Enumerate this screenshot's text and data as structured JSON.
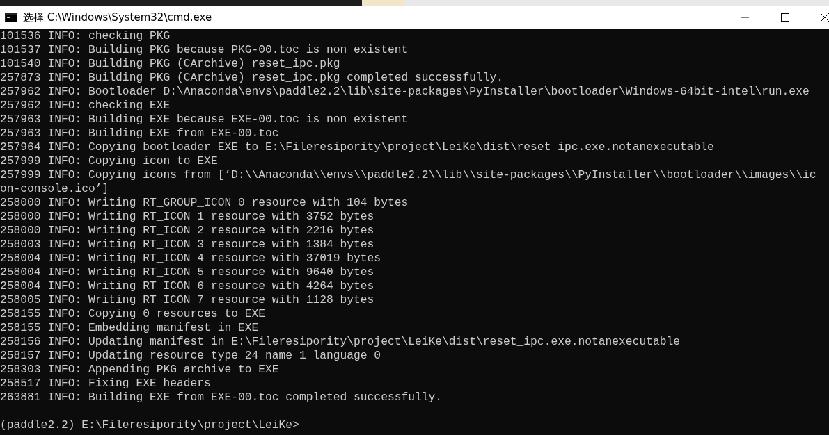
{
  "window": {
    "title": "选择 C:\\Windows\\System32\\cmd.exe"
  },
  "console": {
    "lines": [
      "101536 INFO: checking PKG",
      "101537 INFO: Building PKG because PKG-00.toc is non existent",
      "101540 INFO: Building PKG (CArchive) reset_ipc.pkg",
      "257873 INFO: Building PKG (CArchive) reset_ipc.pkg completed successfully.",
      "257962 INFO: Bootloader D:\\Anaconda\\envs\\paddle2.2\\lib\\site-packages\\PyInstaller\\bootloader\\Windows-64bit-intel\\run.exe",
      "257962 INFO: checking EXE",
      "257963 INFO: Building EXE because EXE-00.toc is non existent",
      "257963 INFO: Building EXE from EXE-00.toc",
      "257964 INFO: Copying bootloader EXE to E:\\Fileresipority\\project\\LeiKe\\dist\\reset_ipc.exe.notanexecutable",
      "257999 INFO: Copying icon to EXE",
      "257999 INFO: Copying icons from [’D:\\\\Anaconda\\\\envs\\\\paddle2.2\\\\lib\\\\site-packages\\\\PyInstaller\\\\bootloader\\\\images\\\\ic",
      "on-console.ico’]",
      "258000 INFO: Writing RT_GROUP_ICON 0 resource with 104 bytes",
      "258000 INFO: Writing RT_ICON 1 resource with 3752 bytes",
      "258000 INFO: Writing RT_ICON 2 resource with 2216 bytes",
      "258003 INFO: Writing RT_ICON 3 resource with 1384 bytes",
      "258004 INFO: Writing RT_ICON 4 resource with 37019 bytes",
      "258004 INFO: Writing RT_ICON 5 resource with 9640 bytes",
      "258004 INFO: Writing RT_ICON 6 resource with 4264 bytes",
      "258005 INFO: Writing RT_ICON 7 resource with 1128 bytes",
      "258155 INFO: Copying 0 resources to EXE",
      "258155 INFO: Embedding manifest in EXE",
      "258156 INFO: Updating manifest in E:\\Fileresipority\\project\\LeiKe\\dist\\reset_ipc.exe.notanexecutable",
      "258157 INFO: Updating resource type 24 name 1 language 0",
      "258303 INFO: Appending PKG archive to EXE",
      "258517 INFO: Fixing EXE headers",
      "263881 INFO: Building EXE from EXE-00.toc completed successfully."
    ],
    "prompt": "(paddle2.2) E:\\Fileresipority\\project\\LeiKe>"
  }
}
